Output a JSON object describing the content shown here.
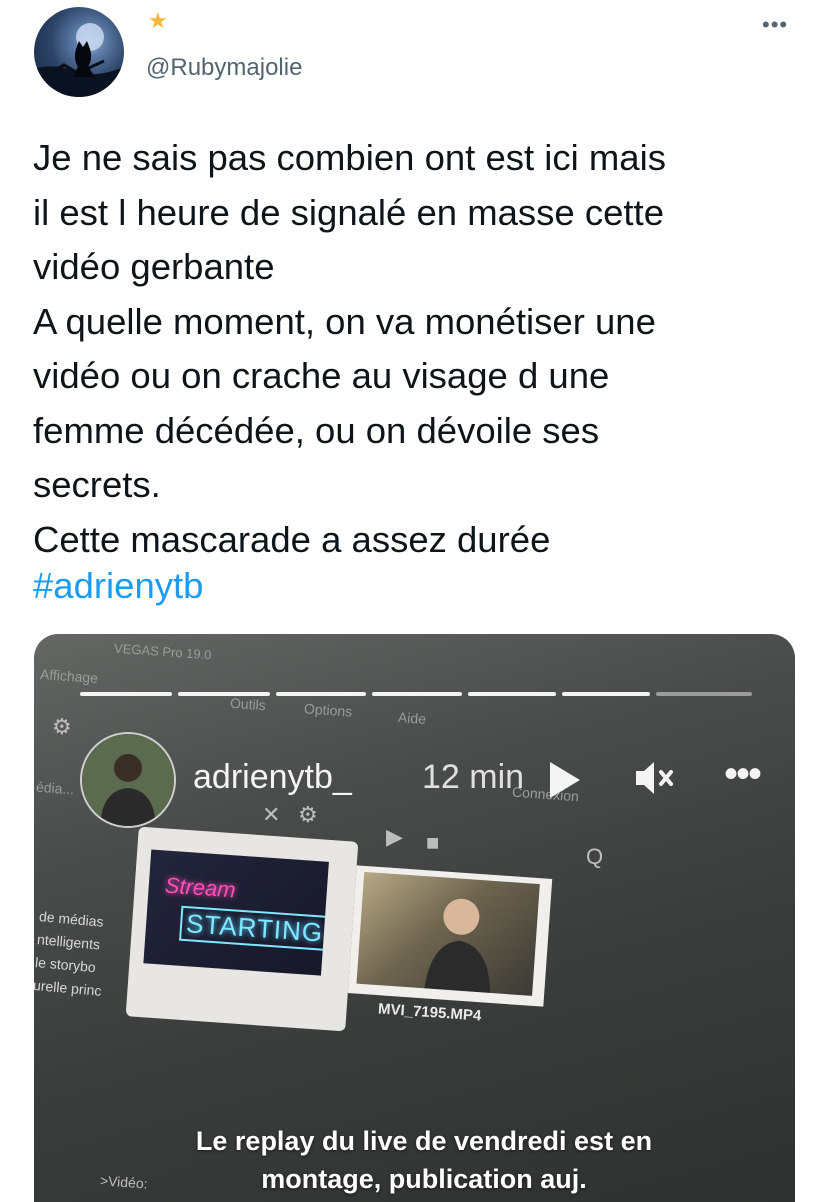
{
  "tweet": {
    "badge_emoji": "★",
    "handle": "@Rubymajolie",
    "more_label": "•••",
    "text": "Je ne sais pas combien ont est ici mais\nil est l heure de signalé en masse cette\nvidéo gerbante\nA quelle moment, on va monétiser une\nvidéo ou on crache au visage d une\nfemme décédée, ou on dévoile ses\nsecrets.\nCette mascarade a assez durée",
    "hashtag": "#adrienytb"
  },
  "story": {
    "username": "adrienytb_",
    "time": "12 min",
    "more_label": "•••",
    "progress_segments_total": 7,
    "caption_line1": "Le replay du live de vendredi est en",
    "caption_line2": "montage, publication auj."
  },
  "screen_photo": {
    "window_title": "VEGAS Pro 19.0",
    "menu_affichage": "Affichage",
    "menu_outils": "Outils",
    "menu_options": "Options",
    "menu_aide": "Aide",
    "menu_connexion": "Connexion",
    "left_label": "édia...",
    "sidebar_lines": [
      "de médias",
      "ntelligents",
      "le storybo",
      "urelle princ"
    ],
    "thumb1_line1": "Stream",
    "thumb1_line2": "STARTING",
    "thumb2_filename": "MVI_7195.MP4",
    "bottom_label": ">Vidéo:"
  },
  "colors": {
    "text": "#0f1419",
    "secondary": "#536471",
    "link": "#1d9bf0",
    "badge": "#f5b73b"
  },
  "icons": [
    "cat-moon-avatar",
    "star-badge-icon",
    "more-icon",
    "play-icon",
    "mute-icon",
    "story-more-icon"
  ]
}
